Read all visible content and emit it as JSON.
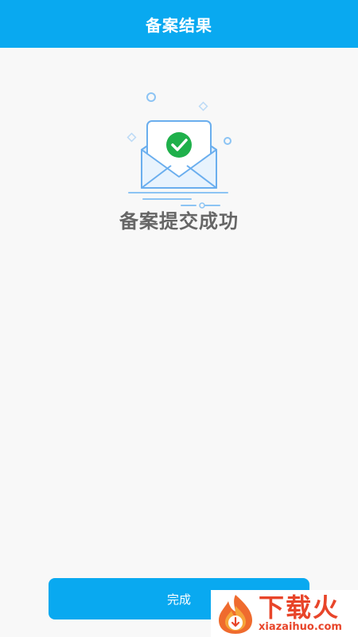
{
  "header": {
    "title": "备案结果"
  },
  "result": {
    "message": "备案提交成功"
  },
  "actions": {
    "done_label": "完成"
  },
  "watermark": {
    "name": "下载火",
    "domain": "xiazaihuo.com"
  },
  "colors": {
    "accent": "#09a9f0",
    "background": "#f8f8f8",
    "success": "#1fb04b",
    "watermark": "#e8452a"
  }
}
